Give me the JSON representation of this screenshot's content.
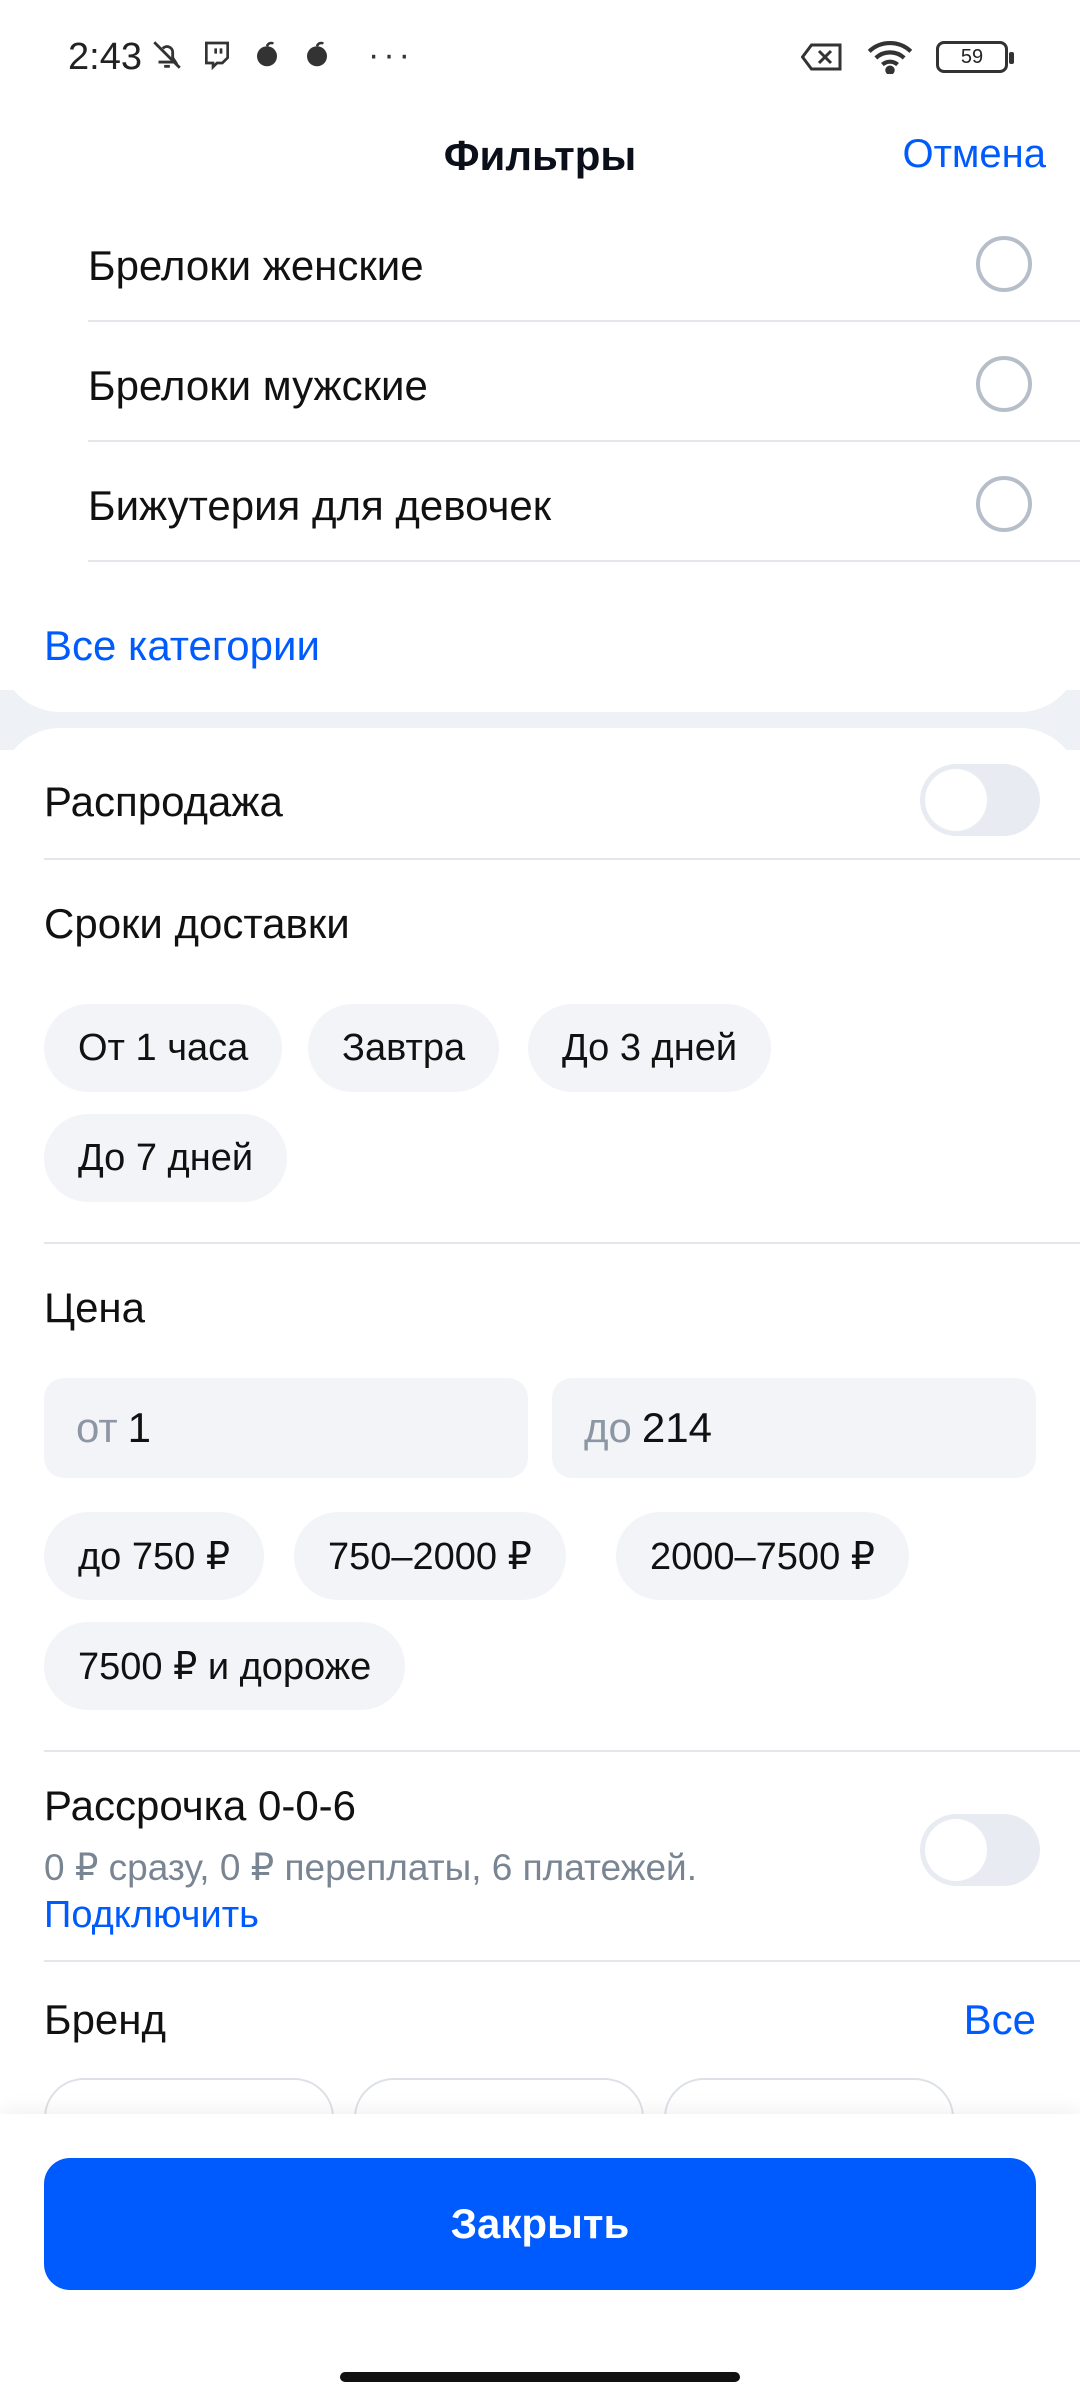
{
  "status_bar": {
    "time": "2:43",
    "battery": "59",
    "dots": "···"
  },
  "header": {
    "title": "Фильтры",
    "cancel": "Отмена"
  },
  "categories": {
    "items": [
      {
        "label": "Брелоки женские",
        "selected": false
      },
      {
        "label": "Брелоки мужские",
        "selected": false
      },
      {
        "label": "Бижутерия для девочек",
        "selected": false
      }
    ],
    "all_link": "Все категории"
  },
  "sale": {
    "label": "Распродажа",
    "enabled": false
  },
  "delivery": {
    "title": "Сроки доставки",
    "options": [
      "От 1 часа",
      "Завтра",
      "До 3 дней",
      "До 7 дней"
    ]
  },
  "price": {
    "title": "Цена",
    "from_placeholder": "от",
    "from_value": "1",
    "to_placeholder": "до",
    "to_value": "214",
    "ranges": [
      "до 750 ₽",
      "750–2000 ₽",
      "2000–7500 ₽",
      "7500 ₽ и дороже"
    ]
  },
  "installment": {
    "title": "Рассрочка 0-0-6",
    "subtitle": "0 ₽ сразу, 0 ₽ переплаты, 6 платежей.",
    "connect": "Подключить",
    "enabled": false
  },
  "brand": {
    "title": "Бренд",
    "all_link": "Все"
  },
  "footer": {
    "close_button": "Закрыть"
  },
  "colors": {
    "accent": "#005bff",
    "chip_bg": "#f2f4f8",
    "divider": "#e3e6eb"
  }
}
